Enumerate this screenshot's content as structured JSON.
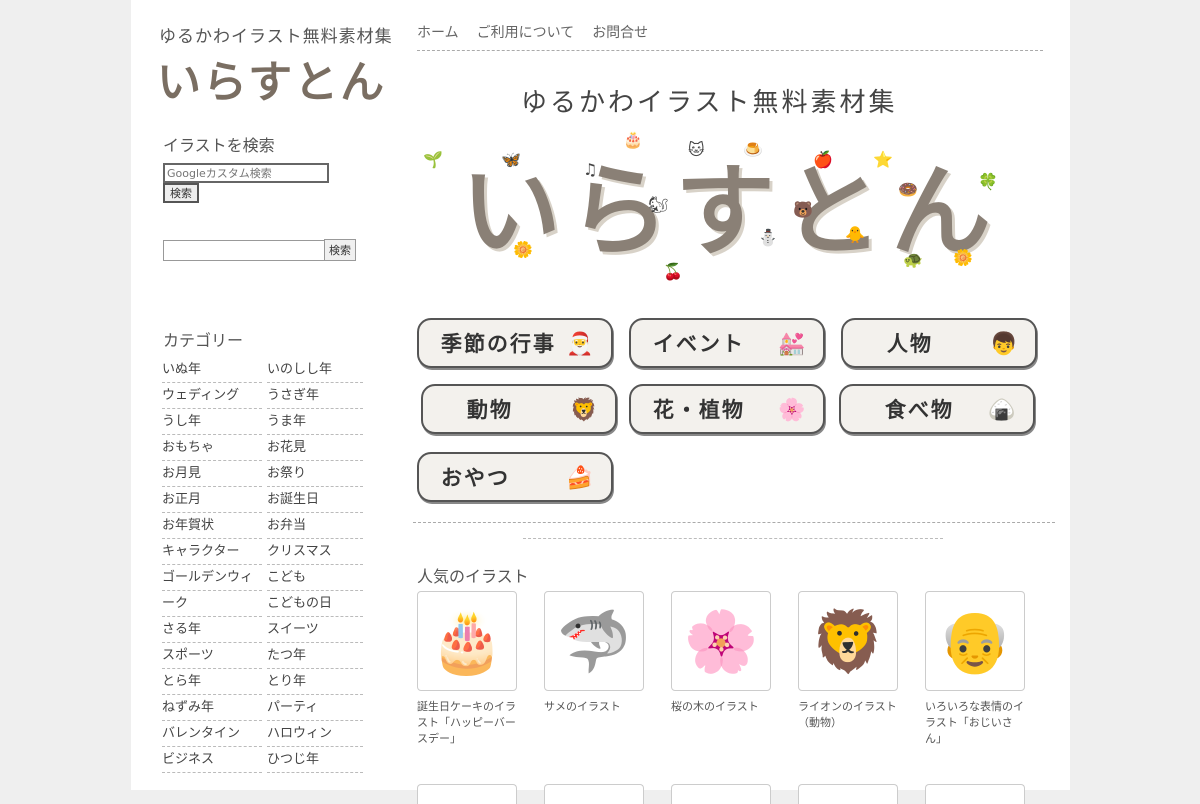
{
  "site": {
    "tagline": "ゆるかわイラスト無料素材集",
    "logo": "いらすとん"
  },
  "nav": [
    "ホーム",
    "ご利用について",
    "お問合せ"
  ],
  "search": {
    "heading": "イラストを検索",
    "gcse_placeholder": "Googleカスタム検索",
    "gcse_button": "検索",
    "site_value": "",
    "site_button": "検索"
  },
  "categories_heading": "カテゴリー",
  "categories": [
    [
      "いぬ年",
      "いのしし年"
    ],
    [
      "ウェディング",
      "うさぎ年"
    ],
    [
      "うし年",
      "うま年"
    ],
    [
      "おもちゃ",
      "お花見"
    ],
    [
      "お月見",
      "お祭り"
    ],
    [
      "お正月",
      "お誕生日"
    ],
    [
      "お年賀状",
      "お弁当"
    ],
    [
      "キャラクター",
      "クリスマス"
    ],
    [
      "ゴールデンウィ",
      "こども"
    ],
    [
      "ーク",
      "こどもの日"
    ],
    [
      "さる年",
      "スイーツ"
    ],
    [
      "スポーツ",
      "たつ年"
    ],
    [
      "とら年",
      "とり年"
    ],
    [
      "ねずみ年",
      "パーティ"
    ],
    [
      "バレンタイン",
      "ハロウィン"
    ],
    [
      "ビジネス",
      "ひつじ年"
    ]
  ],
  "hero": {
    "tagline": "ゆるかわイラスト無料素材集",
    "title": "いらすとん"
  },
  "category_buttons": [
    {
      "label": "季節の行事",
      "icon": "santa-icon",
      "glyph": "🎅"
    },
    {
      "label": "イベント",
      "icon": "wedding-couple-icon",
      "glyph": "💒"
    },
    {
      "label": "人物",
      "icon": "boy-face-icon",
      "glyph": "👦"
    },
    {
      "label": "動物",
      "icon": "lion-icon",
      "glyph": "🦁"
    },
    {
      "label": "花・植物",
      "icon": "peony-flower-icon",
      "glyph": "🌸"
    },
    {
      "label": "食べ物",
      "icon": "onigiri-icon",
      "glyph": "🍙"
    },
    {
      "label": "おやつ",
      "icon": "cake-slice-icon",
      "glyph": "🍰"
    }
  ],
  "popular": {
    "heading": "人気のイラスト",
    "items": [
      {
        "caption": "誕生日ケーキのイラスト「ハッピーバースデー」",
        "icon": "birthday-cake-icon",
        "glyph": "🎂"
      },
      {
        "caption": "サメのイラスト",
        "icon": "shark-icon",
        "glyph": "🦈"
      },
      {
        "caption": "桜の木のイラスト",
        "icon": "cherry-tree-icon",
        "glyph": "🌸"
      },
      {
        "caption": "ライオンのイラスト（動物）",
        "icon": "lion-icon",
        "glyph": "🦁"
      },
      {
        "caption": "いろいろな表情のイラスト「おじいさん」",
        "icon": "old-man-faces-icon",
        "glyph": "👴"
      }
    ]
  },
  "colors": {
    "page_bg": "#efefef",
    "content_bg": "#ffffff",
    "button_bg": "#f3f1ed",
    "logo": "#7a6e62"
  }
}
